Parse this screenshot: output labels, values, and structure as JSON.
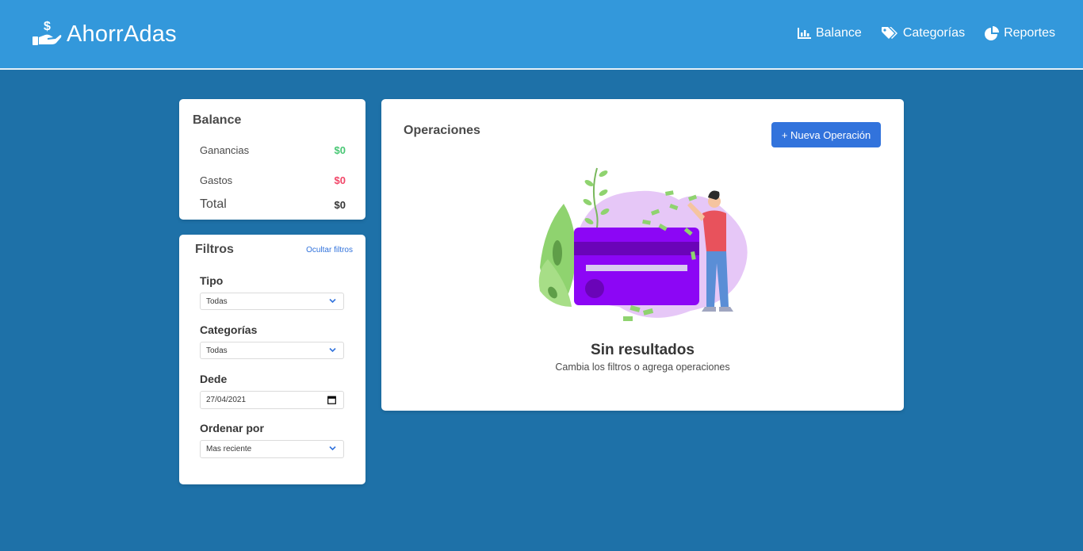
{
  "brand": {
    "name": "AhorrAdas",
    "icon": "hand-holding-usd-icon"
  },
  "nav": [
    {
      "label": "Balance",
      "icon": "chart-bar-icon"
    },
    {
      "label": "Categorías",
      "icon": "tags-icon"
    },
    {
      "label": "Reportes",
      "icon": "chart-pie-icon"
    }
  ],
  "balance": {
    "title": "Balance",
    "ganancias_label": "Ganancias",
    "ganancias_value": "$0",
    "gastos_label": "Gastos",
    "gastos_value": "$0",
    "total_label": "Total",
    "total_value": "$0"
  },
  "filters": {
    "title": "Filtros",
    "hide_link": "Ocultar filtros",
    "tipo_label": "Tipo",
    "tipo_value": "Todas",
    "categorias_label": "Categorías",
    "categorias_value": "Todas",
    "desde_label": "Dede",
    "desde_value": "27/04/2021",
    "ordenar_label": "Ordenar por",
    "ordenar_value": "Mas reciente"
  },
  "operations": {
    "title": "Operaciones",
    "new_button": "+ Nueva Operación",
    "empty_title": "Sin resultados",
    "empty_subtitle": "Cambia los filtros o agrega operaciones"
  },
  "colors": {
    "navbar": "#3398db",
    "background": "#1e71a8",
    "primary": "#3273dc",
    "success": "#48c774",
    "danger": "#f14668"
  }
}
